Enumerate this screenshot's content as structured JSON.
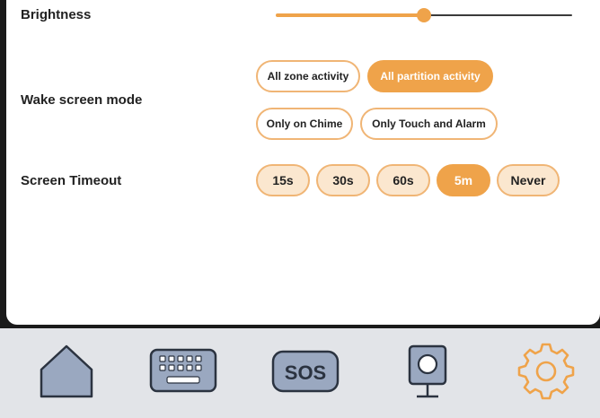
{
  "brightness": {
    "label": "Brightness",
    "level": 0.5
  },
  "wake_screen_mode": {
    "label": "Wake screen mode",
    "options": [
      "All zone activity",
      "All partition activity",
      "Only on Chime",
      "Only Touch and Alarm"
    ],
    "selected": "All partition activity"
  },
  "screen_timeout": {
    "label": "Screen Timeout",
    "options": [
      "15s",
      "30s",
      "60s",
      "5m",
      "Never"
    ],
    "selected": "5m"
  },
  "nav": {
    "sos_label": "SOS",
    "items": [
      "home-icon",
      "keypad-icon",
      "sos-icon",
      "camera-icon",
      "settings-gear-icon"
    ],
    "active": "settings-gear-icon"
  },
  "colors": {
    "accent": "#efa34a",
    "chip_border": "#f0b575",
    "chip_fill_light": "#fbe7cf",
    "nav_icon_fill": "#9aa8c0",
    "nav_icon_stroke": "#2b3340",
    "navbar_bg": "#e2e4e8"
  }
}
